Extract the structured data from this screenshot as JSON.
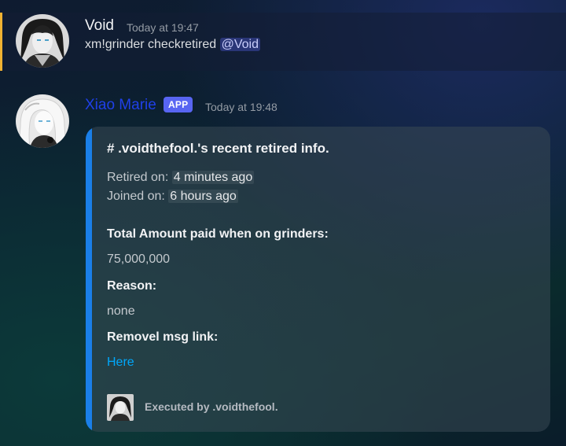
{
  "messages": [
    {
      "author": "Void",
      "timestamp": "Today at 19:47",
      "content_text": "xm!grinder checkretired ",
      "mention": "@Void",
      "highlight_color": "#f0b232"
    },
    {
      "author": "Xiao Marie",
      "author_color": "#1f40e8",
      "badge": "APP",
      "timestamp": "Today at 19:48",
      "embed": {
        "accent_color": "#1a7fe8",
        "title": "# .voidthefool.'s recent retired info.",
        "retired_label": "Retired on: ",
        "retired_value": "4 minutes ago",
        "joined_label": "Joined on: ",
        "joined_value": "6 hours ago",
        "fields": [
          {
            "name": "Total Amount paid when on grinders:",
            "value": "75,000,000"
          },
          {
            "name": "Reason:",
            "value": "none"
          },
          {
            "name": "Removel msg link:",
            "value": "Here"
          }
        ],
        "footer": "Executed by .voidthefool."
      }
    }
  ]
}
